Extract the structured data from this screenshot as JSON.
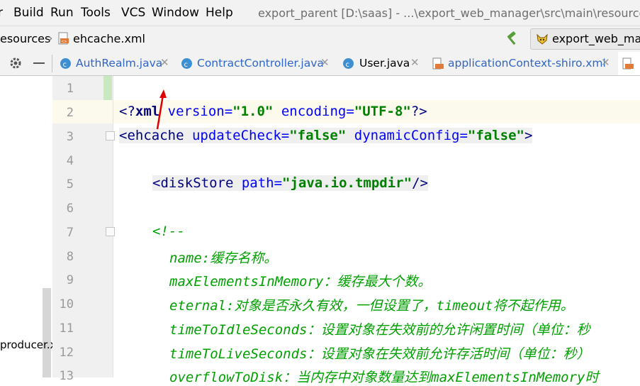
{
  "menubar": {
    "items": [
      {
        "label": "r",
        "underline": ""
      },
      {
        "label": "Build",
        "underline": "B"
      },
      {
        "label": "Run",
        "underline": "u"
      },
      {
        "label": "Tools",
        "underline": "T"
      },
      {
        "label": "VCS",
        "underline": "S"
      },
      {
        "label": "Window",
        "underline": "W"
      },
      {
        "label": "Help",
        "underline": "H"
      }
    ],
    "title": "export_parent [D:\\saas] - ...\\export_web_manager\\src\\main\\resources\\ehca"
  },
  "navbar": {
    "breadcrumb_folder": "esources",
    "breadcrumb_file": "ehcache.xml",
    "run_config_label": "export_web_man"
  },
  "tabs": [
    {
      "label": "AuthRealm.java",
      "icon": "class-icon",
      "color": "#2b2b2b"
    },
    {
      "label": "ContractController.java",
      "icon": "class-icon",
      "color": "#2b2b2b"
    },
    {
      "label": "User.java",
      "icon": "class-icon",
      "color": "#2b2b2b"
    },
    {
      "label": "applicationContext-shiro.xml",
      "icon": "xml-icon",
      "color": "#2b2b2b"
    }
  ],
  "editor": {
    "line_numbers": [
      "1",
      "2",
      "3",
      "4",
      "5",
      "6",
      "7",
      "8",
      "9",
      "10",
      "11",
      "12",
      "13"
    ],
    "line2": {
      "p1": "<?",
      "p2": "xml",
      "p3": " version=",
      "p4": "\"1.0\"",
      "p5": " encoding=",
      "p6": "\"UTF-8\"",
      "p7": "?>"
    },
    "line3": {
      "p1": "<ehcache",
      "p2": " updateCheck=",
      "p3": "\"false\"",
      "p4": " dynamicConfig=",
      "p5": "\"false\"",
      "p6": ">"
    },
    "line5": {
      "p1": "<diskStore",
      "p2": " path=",
      "p3": "\"java.io.tmpdir\"",
      "p4": "/>"
    },
    "line7": "<!--",
    "line8": "name:缓存名称。",
    "line9": "maxElementsInMemory：缓存最大个数。",
    "line10": "eternal:对象是否永久有效，一但设置了，timeout将不起作用。",
    "line11": "timeToIdleSeconds：设置对象在失效前的允许闲置时间（单位：秒",
    "line12": "timeToLiveSeconds：设置对象在失效前允许存活时间（单位：秒）",
    "line13": "overflowToDisk：当内存中对象数量达到maxElementsInMemory时"
  },
  "left_panel": {
    "fragment": "producer.x"
  },
  "colors": {
    "accent": "#2f65ca",
    "tag": "#000080",
    "attr": "#0000ff",
    "string": "#008000",
    "comment": "#00a000",
    "arrow": "#e00000"
  }
}
